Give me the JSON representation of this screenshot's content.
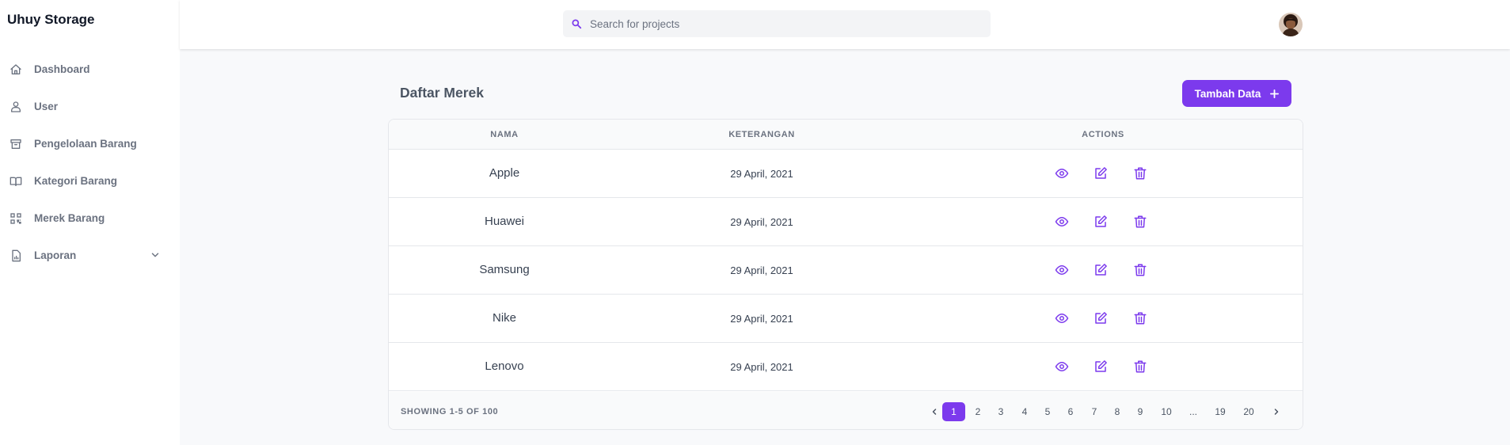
{
  "app": {
    "title": "Uhuy Storage"
  },
  "sidebar": {
    "items": [
      {
        "label": "Dashboard",
        "icon": "home-icon"
      },
      {
        "label": "User",
        "icon": "users-icon"
      },
      {
        "label": "Pengelolaan Barang",
        "icon": "archive-icon"
      },
      {
        "label": "Kategori Barang",
        "icon": "book-icon"
      },
      {
        "label": "Merek Barang",
        "icon": "qrcode-icon"
      },
      {
        "label": "Laporan",
        "icon": "report-icon",
        "expandable": true
      }
    ]
  },
  "search": {
    "placeholder": "Search for projects"
  },
  "main": {
    "title": "Daftar Merek",
    "add_button": "Tambah Data",
    "add_button_icon": "plus-icon"
  },
  "table": {
    "headers": [
      "NAMA",
      "KETERANGAN",
      "ACTIONS"
    ],
    "rows": [
      {
        "nama": "Apple",
        "keterangan": "29 April, 2021"
      },
      {
        "nama": "Huawei",
        "keterangan": "29 April, 2021"
      },
      {
        "nama": "Samsung",
        "keterangan": "29 April, 2021"
      },
      {
        "nama": "Nike",
        "keterangan": "29 April, 2021"
      },
      {
        "nama": "Lenovo",
        "keterangan": "29 April, 2021"
      }
    ],
    "actions": [
      "eye-icon",
      "edit-icon",
      "trash-icon"
    ]
  },
  "pagination": {
    "showing": "SHOWING 1-5 OF 100",
    "pages": [
      "1",
      "2",
      "3",
      "4",
      "5",
      "6",
      "7",
      "8",
      "9",
      "10",
      "...",
      "19",
      "20"
    ],
    "active": "1"
  },
  "colors": {
    "accent": "#7c3aed",
    "sidebar_text": "#6b7280",
    "background": "#f8f9fb"
  }
}
